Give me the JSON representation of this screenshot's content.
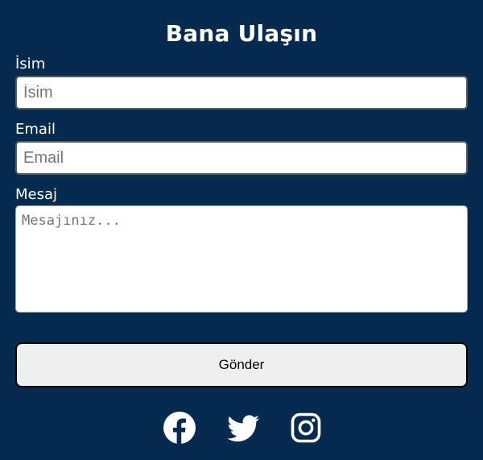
{
  "form": {
    "title": "Bana Ulaşın",
    "name_label": "İsim",
    "name_placeholder": "İsim",
    "email_label": "Email",
    "email_placeholder": "Email",
    "message_label": "Mesaj",
    "message_placeholder": "Mesajınız...",
    "submit_label": "Gönder"
  },
  "social": [
    {
      "icon": "facebook-icon"
    },
    {
      "icon": "twitter-icon"
    },
    {
      "icon": "instagram-icon"
    }
  ],
  "colors": {
    "background": "#062b4f",
    "text": "#ffffff",
    "button_bg": "#efefef"
  }
}
